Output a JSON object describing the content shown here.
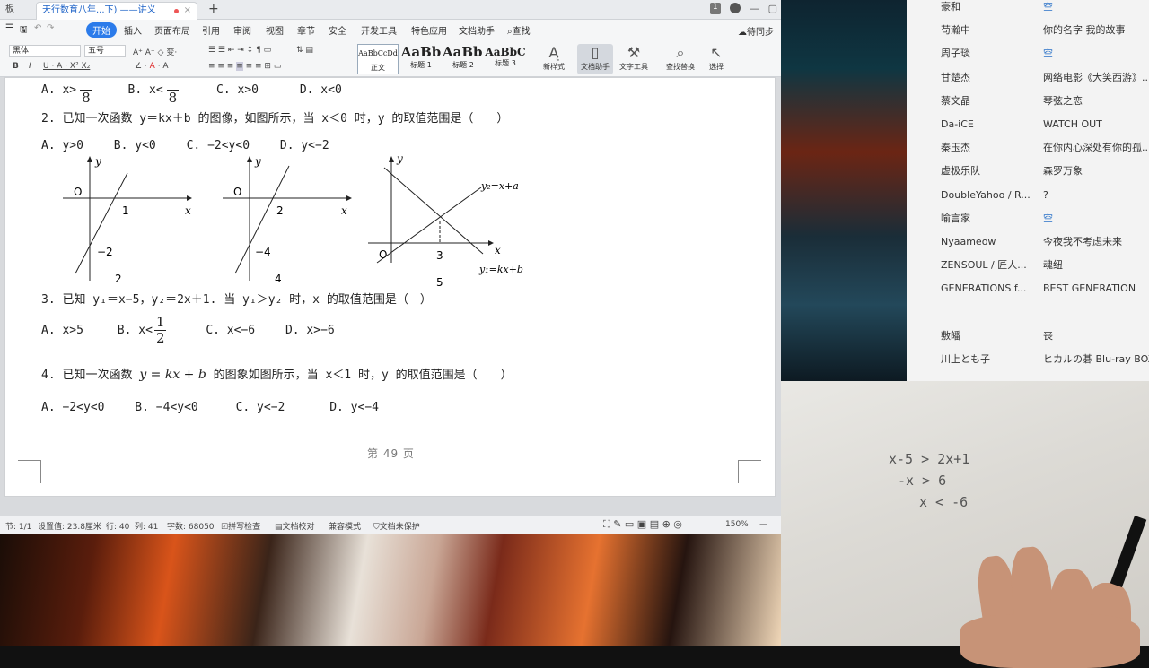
{
  "window": {
    "prev_tab": "板",
    "doc_tab": "天行数育八年...下) ——讲义",
    "status_badge": "1"
  },
  "menu": [
    "开始",
    "插入",
    "页面布局",
    "引用",
    "审阅",
    "视图",
    "章节",
    "安全",
    "开发工具",
    "特色应用",
    "文档助手",
    "查找"
  ],
  "sync_label": "待同步",
  "ribbon": {
    "font_name": "黑体",
    "font_size": "五号",
    "styles": [
      {
        "preview": "AaBbCcDd",
        "label": "正文"
      },
      {
        "preview": "AaBb",
        "label": "标题 1"
      },
      {
        "preview": "AaBb(",
        "label": "标题 2"
      },
      {
        "preview": "AaBbC",
        "label": "标题 3"
      }
    ],
    "new_style": "新样式",
    "tools": [
      "文档助手",
      "文字工具",
      "查找替换",
      "选择"
    ]
  },
  "document": {
    "q1_partial": "A. x>",
    "q1_options": [
      "B. x<",
      "C. x>0",
      "D. x<0"
    ],
    "q1_frac_den": "8",
    "q2": "2. 已知一次函数 y＝kx＋b 的图像，如图所示，当 x＜0 时，y 的取值范围是（　　）",
    "q2_options": [
      "A. y>0",
      "B. y<0",
      "C. −2<y<0",
      "D. y<−2"
    ],
    "graphs": {
      "g1": {
        "y": "y",
        "o": "O",
        "x": "x",
        "x_int": "1",
        "y_int": "−2",
        "caption": "2"
      },
      "g2": {
        "y": "y",
        "o": "O",
        "x": "x",
        "x_int": "2",
        "y_int": "−4",
        "caption": "4"
      },
      "g3": {
        "y": "y",
        "o": "O",
        "x": "x",
        "x_val": "3",
        "line2": "y₂=x+a",
        "line1": "y₁=kx+b",
        "caption": "5"
      }
    },
    "q3": "3. 已知 y₁＝x−5，y₂＝2x＋1. 当 y₁＞y₂ 时，x 的取值范围是（　）",
    "q3_options": [
      "A. x>5",
      "B. x<",
      "C. x<−6",
      "D. x>−6"
    ],
    "q3_frac": {
      "num": "1",
      "den": "2"
    },
    "q4_prefix": "4. 已知一次函数",
    "q4_math": "y = kx + b",
    "q4_suffix": "的图象如图所示，当 x＜1 时，y 的取值范围是（　　）",
    "q4_options": [
      "A. −2<y<0",
      "B. −4<y<0",
      "C. y<−2",
      "D. y<−4"
    ],
    "page_number": "第 49 页"
  },
  "statusbar": {
    "section": "节: 1/1",
    "setting": "设置值: 23.8厘米",
    "row": "行: 40",
    "col": "列: 41",
    "words": "字数: 68050",
    "spell": "拼写检查",
    "proof": "文档校对",
    "compat": "兼容模式",
    "protect": "文档未保护",
    "zoom": "150%"
  },
  "playlist": [
    {
      "artist": "豪和",
      "song": "空",
      "blue": true
    },
    {
      "artist": "苟瀚中",
      "song": "你的名字 我的故事",
      "blue": false
    },
    {
      "artist": "周子琰",
      "song": "空",
      "blue": true
    },
    {
      "artist": "甘楚杰",
      "song": "网络电影《大笑西游》...",
      "blue": false
    },
    {
      "artist": "蔡文晶",
      "song": "琴弦之恋",
      "blue": false
    },
    {
      "artist": "Da-iCE",
      "song": "WATCH OUT",
      "blue": false
    },
    {
      "artist": "秦玉杰",
      "song": "在你内心深处有你的孤...",
      "blue": false
    },
    {
      "artist": "虚极乐队",
      "song": "森罗万象",
      "blue": false
    },
    {
      "artist": "DoubleYahoo / R...",
      "song": "?",
      "blue": false
    },
    {
      "artist": "喻言家",
      "song": "空",
      "blue": true
    },
    {
      "artist": "Nyaameow",
      "song": "今夜我不考虑未来",
      "blue": false
    },
    {
      "artist": "ZENSOUL / 匠人...",
      "song": "魂纽",
      "blue": false
    },
    {
      "artist": "GENERATIONS f...",
      "song": "BEST GENERATION",
      "blue": false
    },
    {
      "artist": "",
      "song": "",
      "blue": false
    },
    {
      "artist": "敷皤",
      "song": "丧",
      "blue": false
    },
    {
      "artist": "川上とも子",
      "song": "ヒカルの碁 Blu-ray BOX...",
      "blue": false
    }
  ],
  "handwriting": [
    "x-5 > 2x+1",
    "-x > 6",
    "x < -6"
  ]
}
